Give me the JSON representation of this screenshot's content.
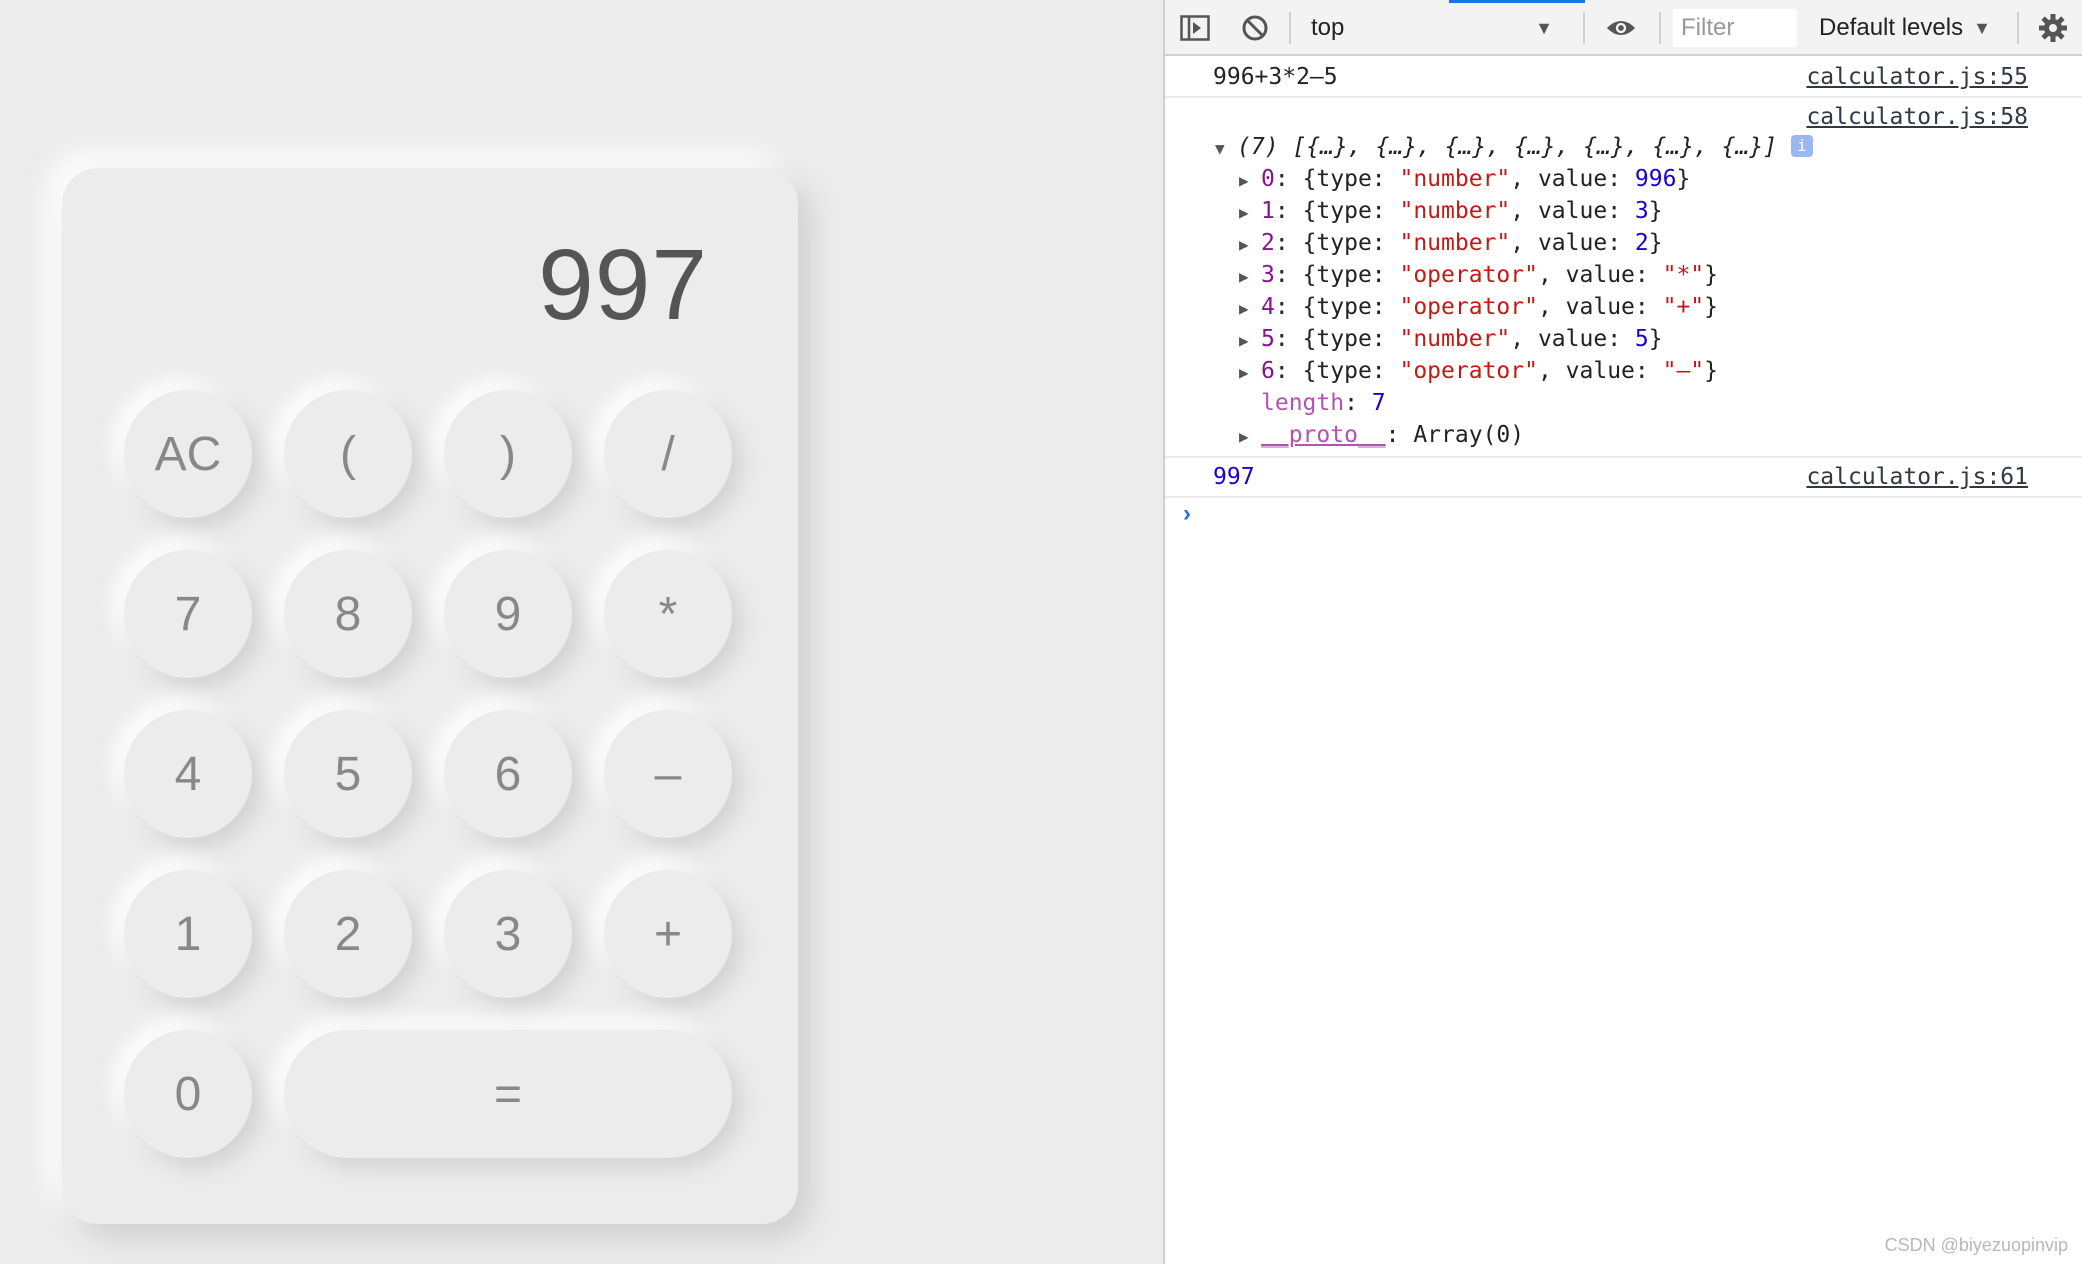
{
  "calculator": {
    "display_value": "997",
    "keys": {
      "ac": "AC",
      "lparen": "(",
      "rparen": ")",
      "divide": "/",
      "seven": "7",
      "eight": "8",
      "nine": "9",
      "multiply": "*",
      "four": "4",
      "five": "5",
      "six": "6",
      "minus": "–",
      "one": "1",
      "two": "2",
      "three": "3",
      "plus": "+",
      "zero": "0",
      "equals": "="
    }
  },
  "devtools": {
    "context": "top",
    "filter_placeholder": "Filter",
    "levels_label": "Default levels",
    "messages": {
      "expr": {
        "text": "996+3*2–5",
        "source": "calculator.js:55"
      },
      "array": {
        "source": "calculator.js:58",
        "summary": "(7) [{…}, {…}, {…}, {…}, {…}, {…}, {…}]",
        "items": [
          {
            "index": "0",
            "type": "\"number\"",
            "value": "996",
            "kind": "num"
          },
          {
            "index": "1",
            "type": "\"number\"",
            "value": "3",
            "kind": "num"
          },
          {
            "index": "2",
            "type": "\"number\"",
            "value": "2",
            "kind": "num"
          },
          {
            "index": "3",
            "type": "\"operator\"",
            "value": "\"*\"",
            "kind": "str"
          },
          {
            "index": "4",
            "type": "\"operator\"",
            "value": "\"+\"",
            "kind": "str"
          },
          {
            "index": "5",
            "type": "\"number\"",
            "value": "5",
            "kind": "num"
          },
          {
            "index": "6",
            "type": "\"operator\"",
            "value": "\"–\"",
            "kind": "str"
          }
        ],
        "length_key": "length",
        "length_value": "7",
        "proto_key": "__proto__",
        "proto_value": "Array(0)"
      },
      "result": {
        "text": "997",
        "source": "calculator.js:61"
      }
    }
  },
  "watermark": "CSDN @biyezuopinvip",
  "colors": {
    "background": "#ececec",
    "accent": "#1a73e8",
    "string": "#c41a16",
    "number": "#1c00cf",
    "index": "#881391"
  }
}
